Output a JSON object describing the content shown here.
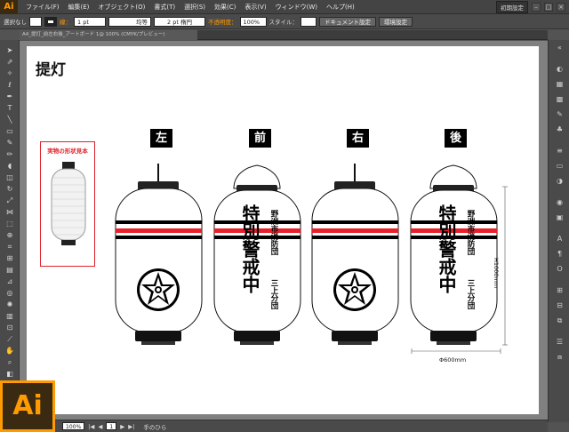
{
  "app": {
    "logo": "Ai",
    "big_logo": "Ai"
  },
  "menu": [
    "ファイル(F)",
    "編集(E)",
    "オブジェクト(O)",
    "書式(T)",
    "選択(S)",
    "効果(C)",
    "表示(V)",
    "ウィンドウ(W)",
    "ヘルプ(H)"
  ],
  "workspace": "初期設定",
  "control": {
    "selection": "選択なし",
    "stroke_label": "線：",
    "stroke_value": "1 pt",
    "line_style": "均等",
    "brush": "2 pt 楕円",
    "opacity_label": "不透明度：",
    "opacity_value": "100%",
    "style_label": "スタイル：",
    "doc_settings": "ドキュメント設定",
    "prefs": "環境設定"
  },
  "document": {
    "tab_title": "A4_提灯_前左右後_アートボード 1@ 100% (CMYK/プレビュー)"
  },
  "artboard": {
    "title": "提灯",
    "sample_label": "実物の形状見本",
    "views": [
      "左",
      "前",
      "右",
      "後"
    ],
    "org_line1": "野洲市消防団",
    "org_line2": "三上分団",
    "main_text": "特別警戒中",
    "width_dim": "Φ600mm",
    "height_dim": "H1000mm"
  },
  "status": {
    "zoom": "100%",
    "page": "1",
    "tool": "手のひら"
  },
  "colors": {
    "accent": "#ff9a00",
    "stripe_red": "#e8202a",
    "sample_border": "#e0202a"
  }
}
